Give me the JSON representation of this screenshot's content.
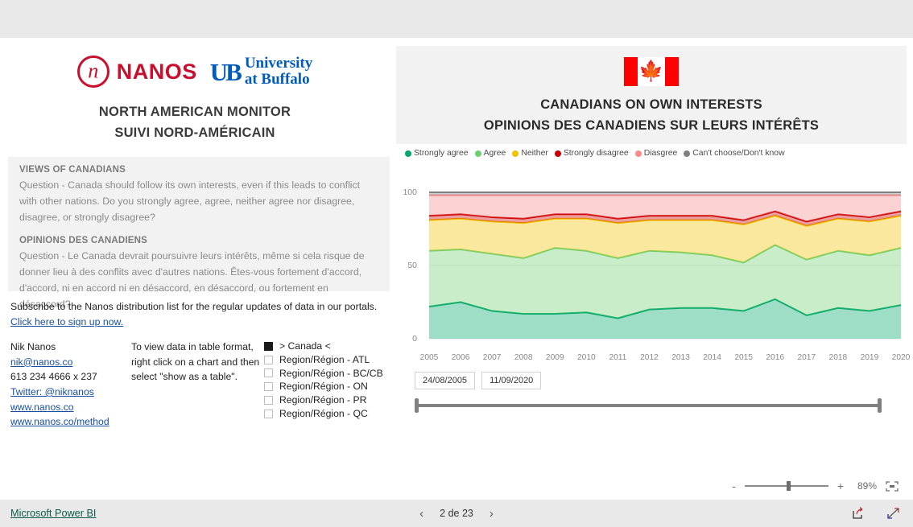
{
  "left": {
    "brand": {
      "nanos_word": "NANOS",
      "nanos_mark_letter": "n",
      "ub_mark": "UB",
      "ub_line1": "University",
      "ub_line2": "at Buffalo"
    },
    "title_en": "NORTH AMERICAN MONITOR",
    "title_fr": "SUIVI NORD-AMÉRICAIN",
    "views_en_head": "VIEWS OF CANADIANS",
    "views_en_body": "Question - Canada should follow its own interests, even if this leads to conflict with other nations. Do you strongly agree, agree, neither agree nor disagree, disagree, or strongly disagree?",
    "views_fr_head": "OPINIONS DES CANADIENS",
    "views_fr_body": "Question - Le Canada devrait poursuivre leurs intérêts, même si cela risque de donner lieu à des conflits avec d'autres nations. Êtes-vous fortement d'accord, d'accord, ni en accord ni en désaccord, en désaccord, ou fortement en désaccord?",
    "subscribe_text": "Subscribe to the Nanos distribution list for the regular updates of data in our portals. ",
    "subscribe_link": "Click here to sign up now.",
    "contact": {
      "name": "Nik Nanos",
      "email": "nik@nanos.co",
      "phone": "613 234 4666 x 237",
      "twitter": "Twitter: @niknanos",
      "site": "www.nanos.co",
      "method": "www.nanos.co/method"
    },
    "hint": "To view data in table format, right click on a chart and then select \"show as a table\".",
    "regions": [
      {
        "label": "> Canada <",
        "checked": true
      },
      {
        "label": "Region/Région - ATL",
        "checked": false
      },
      {
        "label": "Region/Région - BC/CB",
        "checked": false
      },
      {
        "label": "Region/Région - ON",
        "checked": false
      },
      {
        "label": "Region/Région - PR",
        "checked": false
      },
      {
        "label": "Region/Région - QC",
        "checked": false
      }
    ]
  },
  "right": {
    "flag_alt": "canada-flag",
    "title_en": "CANADIANS ON OWN INTERESTS",
    "title_fr": "OPINIONS DES CANADIENS SUR LEURS INTÉRÊTS",
    "date_from": "24/08/2005",
    "date_to": "11/09/2020"
  },
  "chart_data": {
    "type": "area",
    "stacked": true,
    "title": "CANADIANS ON OWN INTERESTS",
    "xlabel": "",
    "ylabel": "",
    "ylim": [
      0,
      100
    ],
    "yticks": [
      0,
      50,
      100
    ],
    "grid": true,
    "legend_position": "top-left",
    "categories": [
      "2005",
      "2006",
      "2007",
      "2008",
      "2009",
      "2010",
      "2011",
      "2012",
      "2013",
      "2014",
      "2015",
      "2016",
      "2017",
      "2018",
      "2019",
      "2020"
    ],
    "series": [
      {
        "name": "Strongly agree",
        "color": "#00a86b",
        "values": [
          22,
          25,
          19,
          17,
          17,
          18,
          14,
          20,
          21,
          21,
          19,
          27,
          16,
          21,
          19,
          23
        ]
      },
      {
        "name": "Agree",
        "color": "#6fd06f",
        "values": [
          38,
          36,
          39,
          38,
          45,
          42,
          41,
          40,
          38,
          36,
          33,
          37,
          38,
          39,
          38,
          39
        ]
      },
      {
        "name": "Neither",
        "color": "#f2c200",
        "values": [
          21,
          21,
          22,
          24,
          20,
          22,
          24,
          21,
          22,
          24,
          26,
          20,
          23,
          22,
          23,
          22
        ]
      },
      {
        "name": "Strongly disagree",
        "color": "#cc0000",
        "values": [
          3,
          3,
          3,
          3,
          3,
          3,
          3,
          3,
          3,
          3,
          3,
          3,
          3,
          3,
          3,
          3
        ]
      },
      {
        "name": "Diasgree",
        "color": "#fb8a8a",
        "values": [
          14,
          13,
          15,
          16,
          13,
          13,
          16,
          14,
          14,
          14,
          17,
          11,
          18,
          13,
          15,
          11
        ]
      },
      {
        "name": "Can't choose/Don't know",
        "color": "#808080",
        "values": [
          2,
          2,
          2,
          2,
          2,
          2,
          2,
          2,
          2,
          2,
          2,
          2,
          2,
          2,
          2,
          2
        ]
      }
    ]
  },
  "footer": {
    "zoom_minus": "-",
    "zoom_plus": "+",
    "zoom_pct": "89%",
    "fit_icon": "fit-to-page-icon",
    "powerbi_label": "Microsoft Power BI",
    "page_label": "2 de 23",
    "prev_icon": "chevron-left-icon",
    "next_icon": "chevron-right-icon",
    "share_icon": "share-icon",
    "fullscreen_icon": "fullscreen-icon"
  }
}
